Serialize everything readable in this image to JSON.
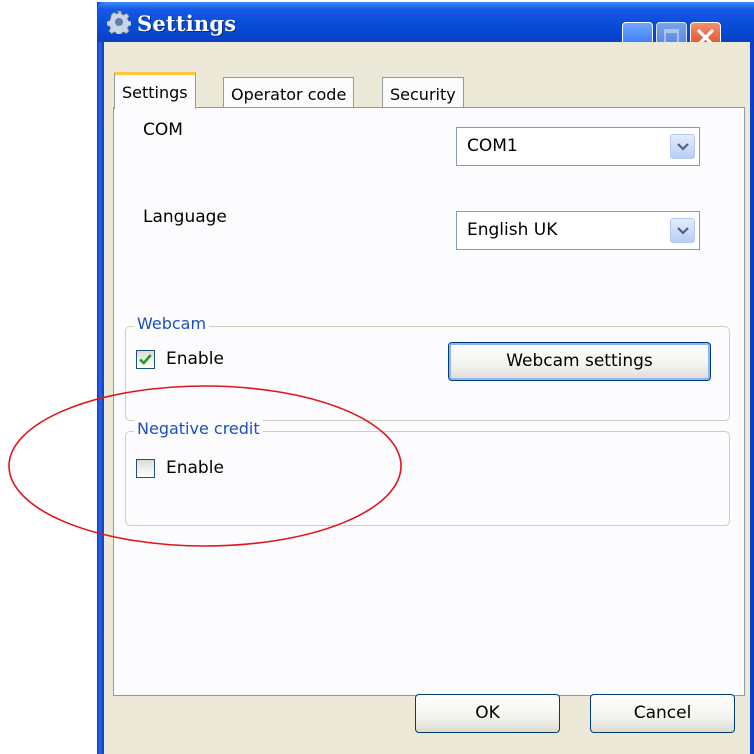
{
  "window": {
    "title": "Settings",
    "icon": "gear-icon"
  },
  "tabs": [
    {
      "label": "Settings",
      "active": true
    },
    {
      "label": "Operator code",
      "active": false
    },
    {
      "label": "Security",
      "active": false
    }
  ],
  "settings": {
    "com_label": "COM",
    "com_value": "COM1",
    "language_label": "Language",
    "language_value": "English UK",
    "webcam": {
      "title": "Webcam",
      "enable_label": "Enable",
      "enable_checked": true,
      "settings_button": "Webcam settings"
    },
    "negative_credit": {
      "title": "Negative credit",
      "enable_label": "Enable",
      "enable_checked": false
    }
  },
  "footer": {
    "ok_label": "OK",
    "cancel_label": "Cancel"
  },
  "colors": {
    "titlebar": "#0a4fd8",
    "group_title": "#1d4fbf",
    "annotation": "#e0141e",
    "check_mark": "#21a121"
  }
}
